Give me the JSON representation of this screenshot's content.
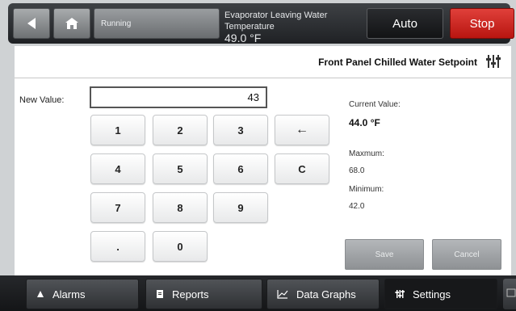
{
  "topbar": {
    "status_text": "Running",
    "evap_label": "Evaporator Leaving Water Temperature",
    "evap_value": "49.0 °F",
    "auto_label": "Auto",
    "stop_label": "Stop"
  },
  "panel": {
    "title": "Front Panel Chilled Water Setpoint",
    "new_value_label": "New Value:",
    "new_value": "43",
    "keys": [
      "1",
      "2",
      "3",
      "←",
      "4",
      "5",
      "6",
      "C",
      "7",
      "8",
      "9",
      ".",
      "0"
    ],
    "current_value_label": "Current Value:",
    "current_value": "44.0 °F",
    "maximum_label": "Maxmum:",
    "maximum_value": "68.0",
    "minimum_label": "Minimum:",
    "minimum_value": "42.0",
    "save_label": "Save",
    "cancel_label": "Cancel"
  },
  "bottombar": {
    "tabs": [
      {
        "label": "Alarms",
        "icon": "triangle-up-icon"
      },
      {
        "label": "Reports",
        "icon": "document-icon"
      },
      {
        "label": "Data Graphs",
        "icon": "chart-icon"
      },
      {
        "label": "Settings",
        "icon": "sliders-icon",
        "active": true
      }
    ]
  },
  "colors": {
    "stop": "#cc2420",
    "auto": "#1a1b1d",
    "disabled_button": "#a3a6a9"
  }
}
